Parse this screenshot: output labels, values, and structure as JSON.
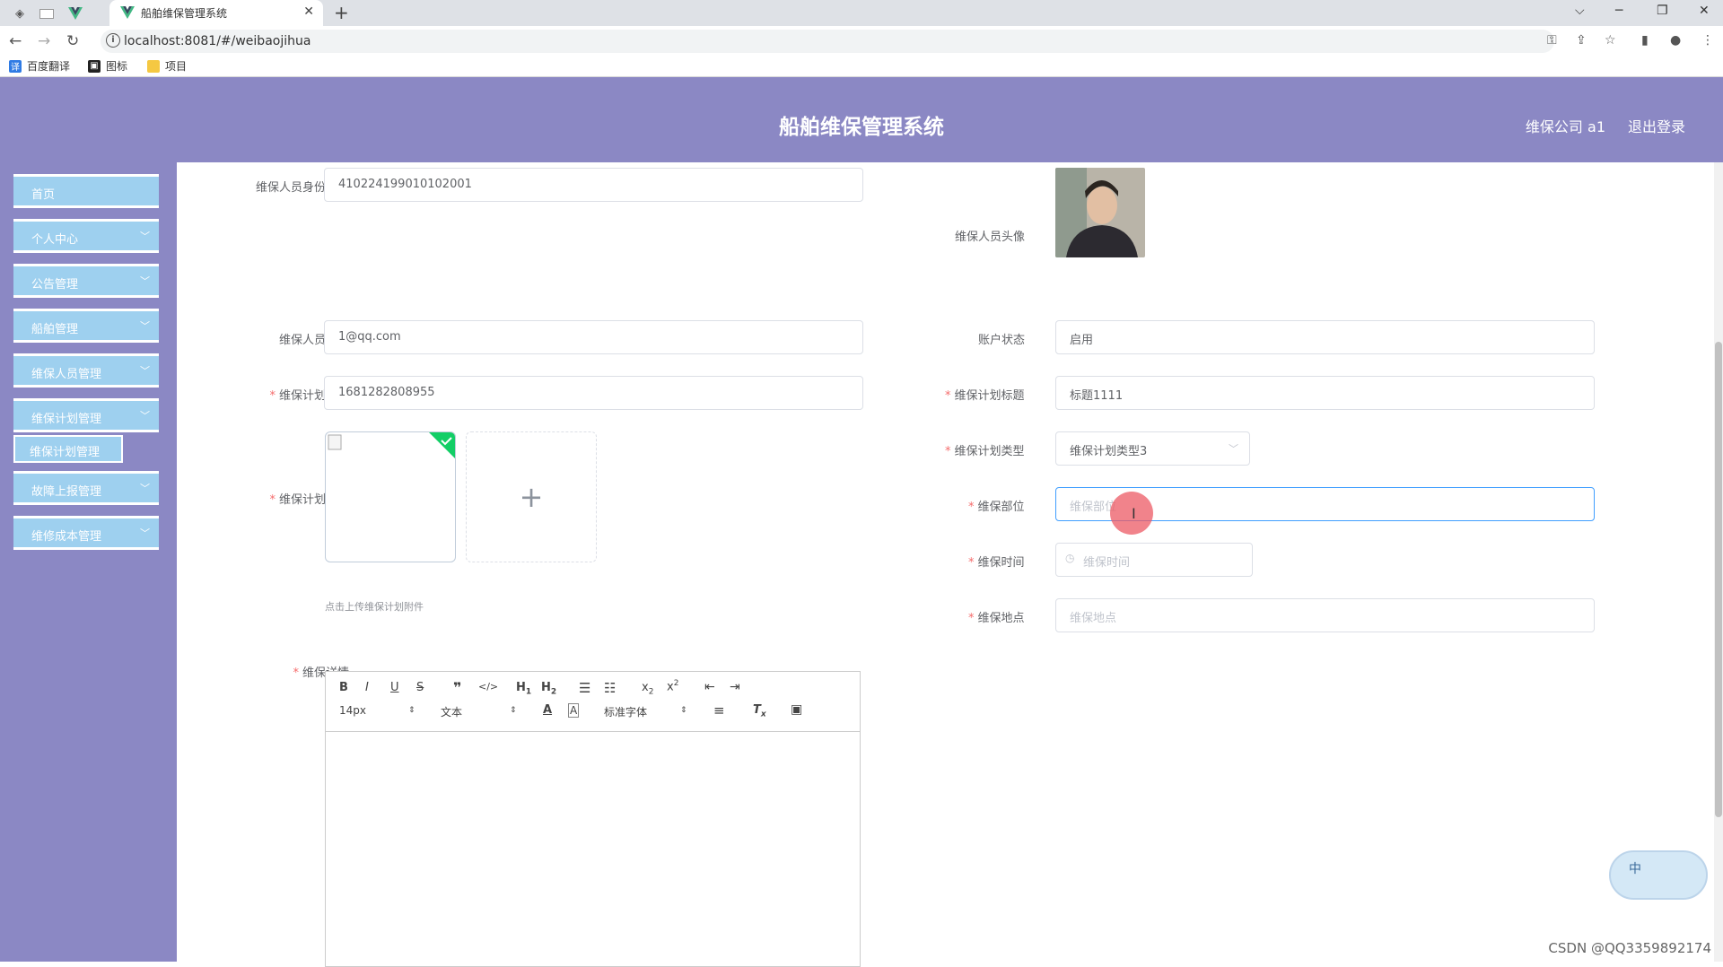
{
  "browser": {
    "tab_title": "船舶维保管理系统",
    "url": "localhost:8081/#/weibaojihua",
    "bookmarks": [
      "百度翻译",
      "图标",
      "项目"
    ]
  },
  "header": {
    "title": "船舶维保管理系统",
    "user": "维保公司 a1",
    "logout": "退出登录"
  },
  "sidebar": {
    "items": [
      {
        "label": "首页",
        "has_chevron": false
      },
      {
        "label": "个人中心",
        "has_chevron": true
      },
      {
        "label": "公告管理",
        "has_chevron": true
      },
      {
        "label": "船舶管理",
        "has_chevron": true
      },
      {
        "label": "维保人员管理",
        "has_chevron": true
      },
      {
        "label": "维保计划管理",
        "has_chevron": true
      }
    ],
    "subitem": "维保计划管理",
    "items_after": [
      {
        "label": "故障上报管理",
        "has_chevron": true
      },
      {
        "label": "维修成本管理",
        "has_chevron": true
      }
    ]
  },
  "form": {
    "id_card": {
      "label": "维保人员身份证号",
      "value": "410224199010102001"
    },
    "avatar": {
      "label": "维保人员头像"
    },
    "email": {
      "label": "维保人员邮箱",
      "value": "1@qq.com"
    },
    "account_status": {
      "label": "账户状态",
      "value": "启用"
    },
    "plan_no": {
      "label": "维保计划编号",
      "value": "1681282808955"
    },
    "plan_title": {
      "label": "维保计划标题",
      "value": "标题1111"
    },
    "plan_type": {
      "label": "维保计划类型",
      "value": "维保计划类型3"
    },
    "attachment": {
      "label": "维保计划附件",
      "hint": "点击上传维保计划附件"
    },
    "department": {
      "label": "维保部位",
      "placeholder": "维保部位"
    },
    "time": {
      "label": "维保时间",
      "placeholder": "维保时间"
    },
    "location": {
      "label": "维保地点",
      "placeholder": "维保地点"
    },
    "detail": {
      "label": "维保详情"
    }
  },
  "editor": {
    "font_size": "14px",
    "header_select": "文本",
    "font_family": "标准字体"
  },
  "float_widget": {
    "label": "中"
  },
  "watermark": "CSDN @QQ3359892174"
}
